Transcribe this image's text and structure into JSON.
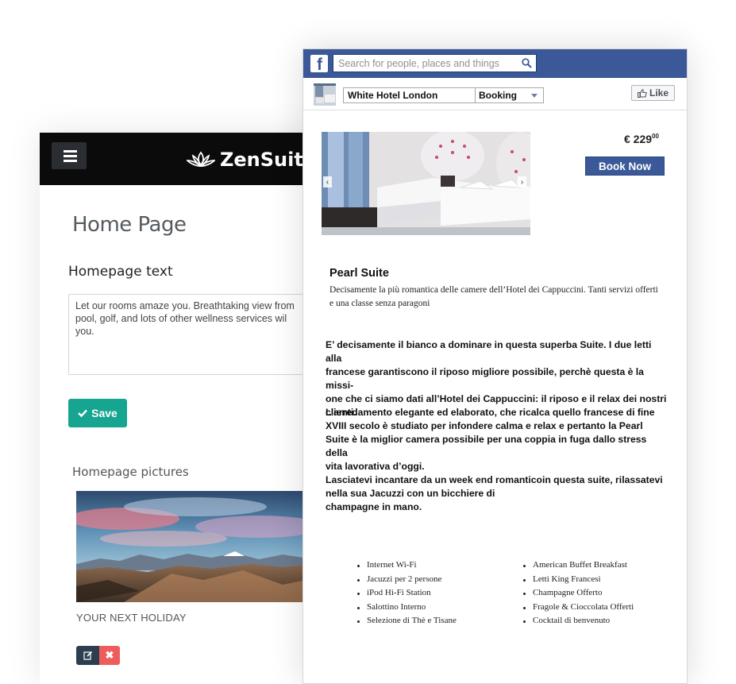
{
  "admin": {
    "brand": "ZenSuite",
    "page_title": "Home Page",
    "homepage_text_title": "Homepage text",
    "homepage_text_value": "Let our rooms amaze you. Breathtaking view from\npool, golf, and lots of other wellness services wil\nyou.",
    "save_label": "Save",
    "pictures_title": "Homepage pictures",
    "picture_caption": "YOUR NEXT HOLIDAY",
    "icons": {
      "menu": "hamburger-icon",
      "logo": "lotus-icon",
      "save": "check-icon",
      "edit": "edit-icon",
      "delete": "close-icon"
    },
    "colors": {
      "header": "#0b0b0b",
      "save": "#16a591",
      "edit": "#2c3e50",
      "delete": "#ef5c5c"
    }
  },
  "facebook": {
    "search_placeholder": "Search for people, places and things",
    "page_name": "White Hotel London",
    "page_tab": "Booking",
    "like_label": "Like",
    "price_main": "€ 229",
    "price_cents": "00",
    "book_now_label": "Book Now",
    "suite_name": "Pearl Suite",
    "suite_description": "Decisamente la più romantica delle camere dell’Hotel dei Cappuccini. Tanti servizi offerti e una classe senza paragoni",
    "paragraphs": [
      "E’ decisamente il bianco a dominare in questa superba Suite. I due letti alla\nfrancese garantiscono il riposo migliore possibile, perchè questa è la missi-\none che ci siamo dati all’Hotel dei Cappuccini: il riposo e il relax dei nostri\nclienti.",
      "L’arredamento elegante ed elaborato, che ricalca quello francese di fine\nXVIII secolo è studiato per infondere calma e relax e pertanto la Pearl\nSuite è la miglior camera possibile per una coppia in fuga dallo stress della\nvita lavorativa d’oggi.",
      "Lasciatevi incantare da un week end romanticoin questa suite, rilassatevi\nnella sua Jacuzzi con un bicchiere di\nchampagne in mano."
    ],
    "amenities_left": [
      "Internet Wi-Fi",
      "Jacuzzi per 2 persone",
      "iPod Hi-Fi Station",
      "Salottino Interno",
      "Selezione di Thè e Tisane"
    ],
    "amenities_right": [
      "American Buffet Breakfast",
      "Letti King Francesi",
      "Champagne Offerto",
      "Fragole & Cioccolata Offerti",
      "Cocktail di benvenuto"
    ],
    "icons": {
      "logo": "facebook-logo-icon",
      "search": "search-icon",
      "like": "thumbs-up-icon",
      "prev": "chevron-left-icon",
      "next": "chevron-right-icon"
    },
    "colors": {
      "bar": "#3b5998",
      "book_now": "#3b5998"
    }
  }
}
